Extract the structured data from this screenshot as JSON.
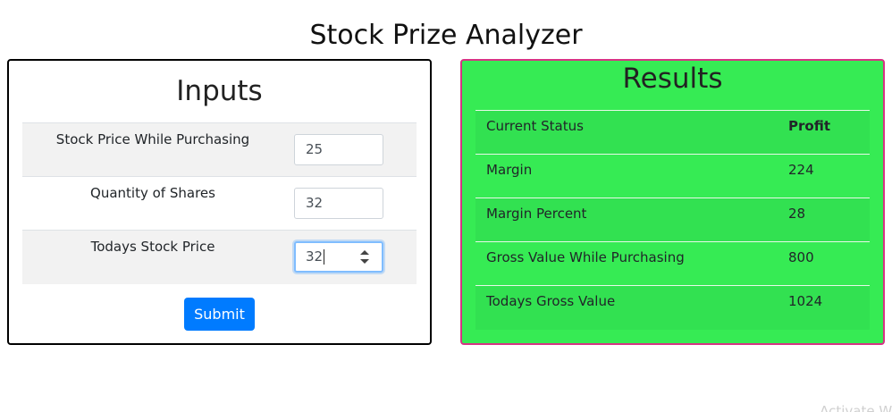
{
  "header": {
    "title": "Stock Prize Analyzer"
  },
  "inputs": {
    "heading": "Inputs",
    "fields": [
      {
        "label": "Stock Price While Purchasing",
        "value": "25"
      },
      {
        "label": "Quantity of Shares",
        "value": "32"
      },
      {
        "label": "Todays Stock Price",
        "value": "32"
      }
    ],
    "submit_label": "Submit"
  },
  "results": {
    "heading": "Results",
    "rows": [
      {
        "label": "Current Status",
        "value": "Profit"
      },
      {
        "label": "Margin",
        "value": "224"
      },
      {
        "label": "Margin Percent",
        "value": "28"
      },
      {
        "label": "Gross Value While Purchasing",
        "value": "800"
      },
      {
        "label": "Todays Gross Value",
        "value": "1024"
      }
    ]
  },
  "watermark": {
    "text": "Activate Wi"
  },
  "colors": {
    "results_bg": "#36eb54",
    "results_border": "#d63384",
    "submit_bg": "#007bff"
  }
}
